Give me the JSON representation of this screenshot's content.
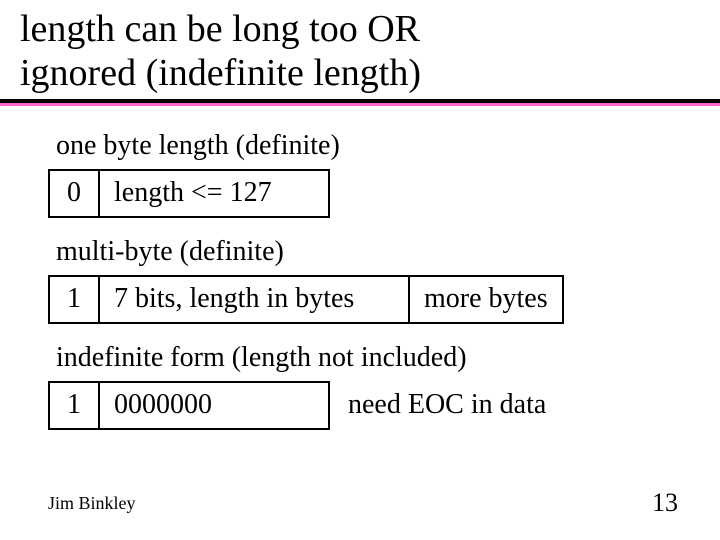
{
  "title_line1": "length can  be long too OR",
  "title_line2": "ignored (indefinite length)",
  "section1": {
    "caption": "one byte length (definite)",
    "c0": "0",
    "c1": "length <= 127"
  },
  "section2": {
    "caption": "multi-byte (definite)",
    "c0": "1",
    "c1": "7 bits, length in bytes",
    "c2": "more bytes"
  },
  "section3": {
    "caption": "indefinite form (length not included)",
    "c0": "1",
    "c1": "0000000",
    "side": "need EOC in data"
  },
  "footer": {
    "author": "Jim Binkley",
    "page": "13"
  }
}
